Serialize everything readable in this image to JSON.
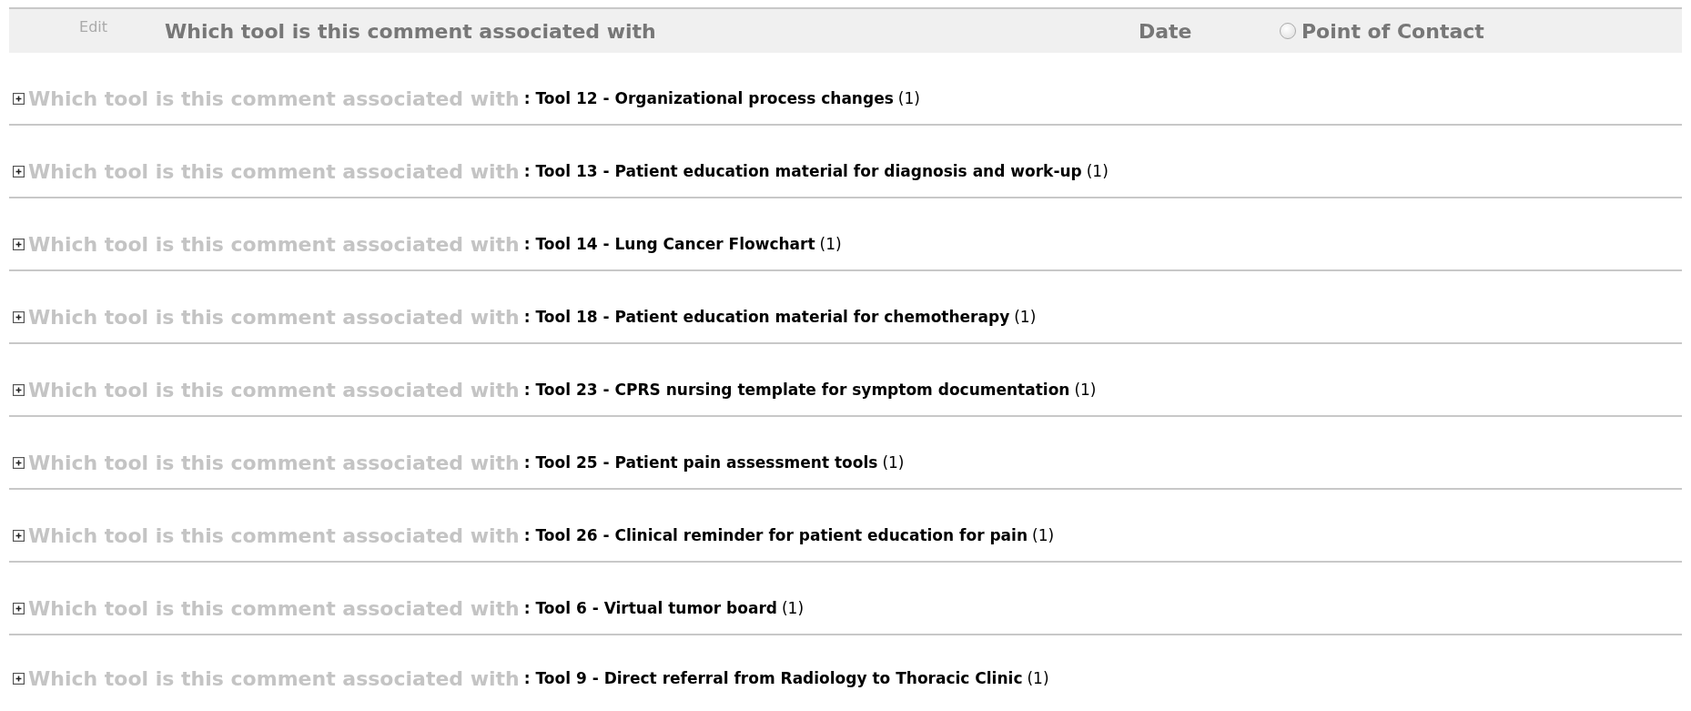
{
  "header": {
    "edit": "Edit",
    "columns": [
      "Which tool is this comment associated with",
      "Date"
    ],
    "point_of_contact": {
      "label": "Point of Contact",
      "selected": false
    }
  },
  "groups": [
    {
      "label": "Which tool is this comment associated with",
      "value": ": Tool 12 - Organizational process changes",
      "count": "(1)",
      "expanded": false
    },
    {
      "label": "Which tool is this comment associated with",
      "value": ": Tool 13 - Patient education material for diagnosis and work-up",
      "count": "(1)",
      "expanded": false
    },
    {
      "label": "Which tool is this comment associated with",
      "value": ": Tool 14 - Lung Cancer Flowchart",
      "count": "(1)",
      "expanded": false
    },
    {
      "label": "Which tool is this comment associated with",
      "value": ": Tool 18 - Patient education material for chemotherapy",
      "count": "(1)",
      "expanded": false
    },
    {
      "label": "Which tool is this comment associated with",
      "value": ": Tool 23 - CPRS nursing template for symptom documentation",
      "count": "(1)",
      "expanded": false
    },
    {
      "label": "Which tool is this comment associated with",
      "value": ": Tool 25 - Patient pain assessment tools",
      "count": "(1)",
      "expanded": false
    },
    {
      "label": "Which tool is this comment associated with",
      "value": ": Tool 26 - Clinical reminder for patient education for pain",
      "count": "(1)",
      "expanded": false
    },
    {
      "label": "Which tool is this comment associated with",
      "value": ": Tool 6 - Virtual tumor board",
      "count": "(1)",
      "expanded": false
    },
    {
      "label": "Which tool is this comment associated with",
      "value": ": Tool 9 - Direct referral from Radiology to Thoracic Clinic",
      "count": "(1)",
      "expanded": false
    }
  ]
}
